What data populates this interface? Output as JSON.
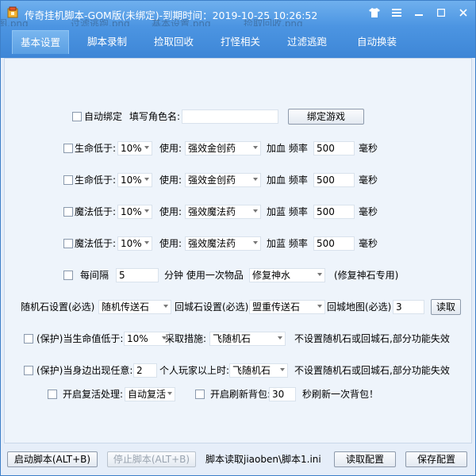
{
  "window": {
    "title": "传奇挂机脚本-GOM版(未绑定)-到期时间：2019-10-25 10:26:52",
    "ghost_texts": [
      "图.png",
      "过滤逃跑.png",
      "基本设置.png",
      "捡取回收.png"
    ]
  },
  "tabs": [
    "基本设置",
    "脚本录制",
    "捡取回收",
    "打怪相关",
    "过滤逃跑",
    "自动换装"
  ],
  "bind": {
    "checkbox_label": "自动绑定",
    "role_name_label": "填写角色名:",
    "role_name_value": "",
    "bind_button": "绑定游戏"
  },
  "potion_rows": [
    {
      "label": "生命低于:",
      "pct": "10%",
      "use_label": "使用:",
      "item": "强效金创药",
      "action": "加血 频率",
      "freq": "500",
      "unit": "毫秒"
    },
    {
      "label": "生命低于:",
      "pct": "10%",
      "use_label": "使用:",
      "item": "强效金创药",
      "action": "加血 频率",
      "freq": "500",
      "unit": "毫秒"
    },
    {
      "label": "魔法低于:",
      "pct": "10%",
      "use_label": "使用:",
      "item": "强效魔法药",
      "action": "加蓝 频率",
      "freq": "500",
      "unit": "毫秒"
    },
    {
      "label": "魔法低于:",
      "pct": "10%",
      "use_label": "使用:",
      "item": "强效魔法药",
      "action": "加蓝 频率",
      "freq": "500",
      "unit": "毫秒"
    }
  ],
  "interval": {
    "label": "每间隔",
    "value": "5",
    "mid_label": "分钟  使用一次物品",
    "item": "修复神水",
    "note": "(修复神石专用)"
  },
  "stones": {
    "random_label": "随机石设置(必选)",
    "random_value": "随机传送石",
    "return_label": "回城石设置(必选)",
    "return_value": "盟重传送石",
    "map_label": "回城地图(必选)",
    "map_value": "3",
    "read_button": "读取"
  },
  "protect_hp": {
    "label": "(保护)当生命值低于:",
    "pct": "10%",
    "measure_label": "采取措施:",
    "measure": "飞随机石",
    "note": "不设置随机石或回城石,部分功能失效"
  },
  "protect_crowd": {
    "label": "(保护)当身边出现任意:",
    "count": "2",
    "mid_label": "个人玩家以上时:",
    "measure": "飞随机石",
    "note": "不设置随机石或回城石,部分功能失效"
  },
  "revive": {
    "label": "开启复活处理:",
    "value": "自动复活",
    "refresh_label": "开启刷新背包:",
    "refresh_value": "30",
    "refresh_suffix": "秒刷新一次背包！"
  },
  "status": {
    "start_button": "启动脚本(ALT+B)",
    "stop_button": "停止脚本(ALT+B)",
    "script_path": "脚本读取jiaoben\\脚本1.ini",
    "read_config": "读取配置",
    "save_config": "保存配置"
  }
}
